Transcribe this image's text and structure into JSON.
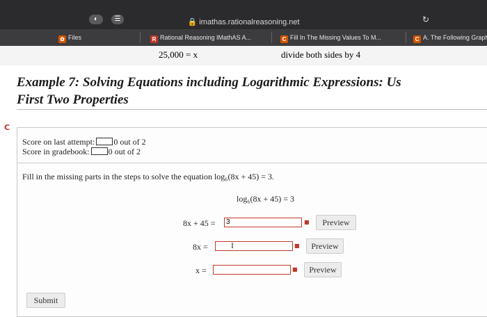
{
  "browser": {
    "url": "imathas.rationalreasoning.net",
    "tabs": [
      {
        "label": "Files",
        "icon": "files-icon",
        "icon_glyph": "✿",
        "color": "#d35400"
      },
      {
        "label": "Rational Reasoning IMathAS A...",
        "icon": "R",
        "color": "#c0392b"
      },
      {
        "label": "Fill In The Missing Values To M...",
        "icon": "C",
        "color": "#d35400"
      },
      {
        "label": "A. The Following Graph",
        "icon": "C",
        "color": "#d35400"
      }
    ]
  },
  "prev_strip": {
    "math_left": "25,000 = x",
    "math_right": "divide both sides by 4"
  },
  "page": {
    "title": "Example 7: Solving Equations including Logarithmic Expressions: Us",
    "title_line2": "First Two Properties",
    "score_last_label": "Score on last attempt:",
    "score_last_value": "0 out of 2",
    "score_grade_label": "Score in gradebook:",
    "score_grade_value": "0 out of 2",
    "question": "Fill in the missing parts in the steps to solve the equation log₆(8x + 45) = 3.",
    "step0": "log₆(8x + 45) = 3",
    "steps": [
      {
        "lhs": "8x + 45 =",
        "value": "3",
        "preview": "Preview"
      },
      {
        "lhs": "8x =",
        "value": "",
        "preview": "Preview"
      },
      {
        "lhs": "x =",
        "value": "",
        "preview": "Preview"
      }
    ],
    "submit": "Submit"
  }
}
